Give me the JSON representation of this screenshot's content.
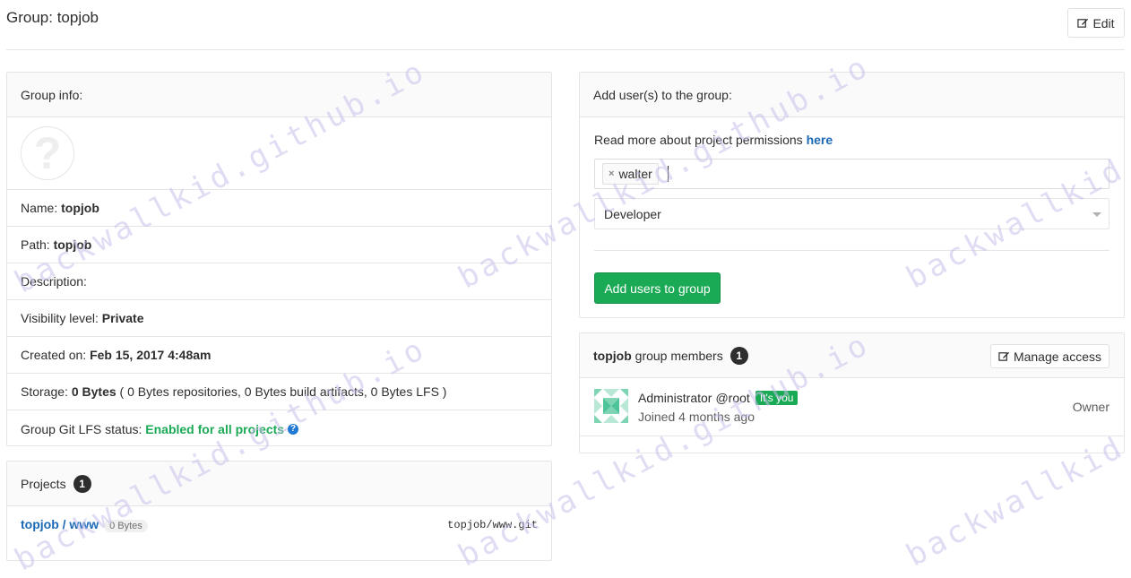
{
  "header": {
    "title": "Group: topjob",
    "edit_label": "Edit"
  },
  "group_info": {
    "heading": "Group info:",
    "name_label": "Name:",
    "name_value": "topjob",
    "path_label": "Path:",
    "path_value": "topjob",
    "description_label": "Description:",
    "visibility_label": "Visibility level:",
    "visibility_value": "Private",
    "created_label": "Created on:",
    "created_value": "Feb 15, 2017 4:48am",
    "storage_label": "Storage:",
    "storage_value": "0 Bytes",
    "storage_detail": "( 0 Bytes repositories, 0 Bytes build artifacts, 0 Bytes LFS )",
    "lfs_label": "Group Git LFS status:",
    "lfs_value": "Enabled for all projects"
  },
  "projects": {
    "heading": "Projects",
    "count": "1",
    "items": [
      {
        "name": "topjob / www",
        "size": "0 Bytes",
        "path": "topjob/www.git"
      }
    ]
  },
  "add_users": {
    "heading": "Add user(s) to the group:",
    "permissions_text": "Read more about project permissions",
    "permissions_link": "here",
    "token": "walter",
    "role": "Developer",
    "submit_label": "Add users to group"
  },
  "members": {
    "group_name": "topjob",
    "heading_suffix": "group members",
    "count": "1",
    "manage_label": "Manage access",
    "items": [
      {
        "name": "Administrator",
        "username": "@root",
        "badge": "It's you",
        "joined": "Joined 4 months ago",
        "role": "Owner"
      }
    ]
  },
  "watermark": "backwallkid.github.io",
  "colors": {
    "success": "#1aaa55",
    "link": "#1b69b6",
    "badge_dark": "#2e2e2e"
  }
}
